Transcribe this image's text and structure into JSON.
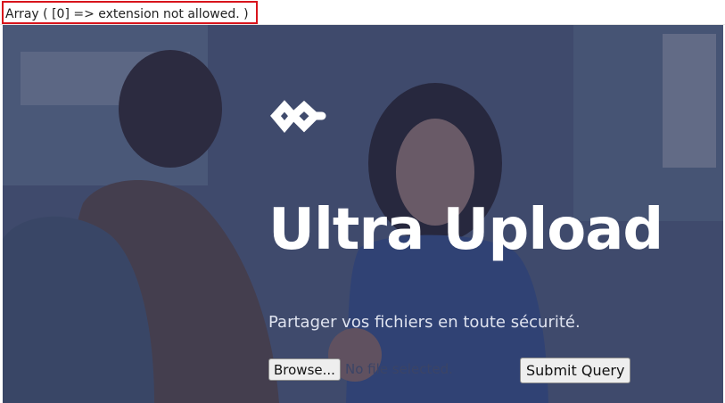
{
  "error": {
    "message": "Array ( [0] => extension not allowed. )",
    "highlight_color": "#d8141c"
  },
  "hero": {
    "title": "Ultra Upload",
    "tagline": "Partager vos fichiers en toute sécurité.",
    "logo_icon": "logo-icon",
    "overlay_color": "#2c3559"
  },
  "form": {
    "browse_label": "Browse...",
    "file_status": "No file selected.",
    "submit_label": "Submit Query"
  }
}
